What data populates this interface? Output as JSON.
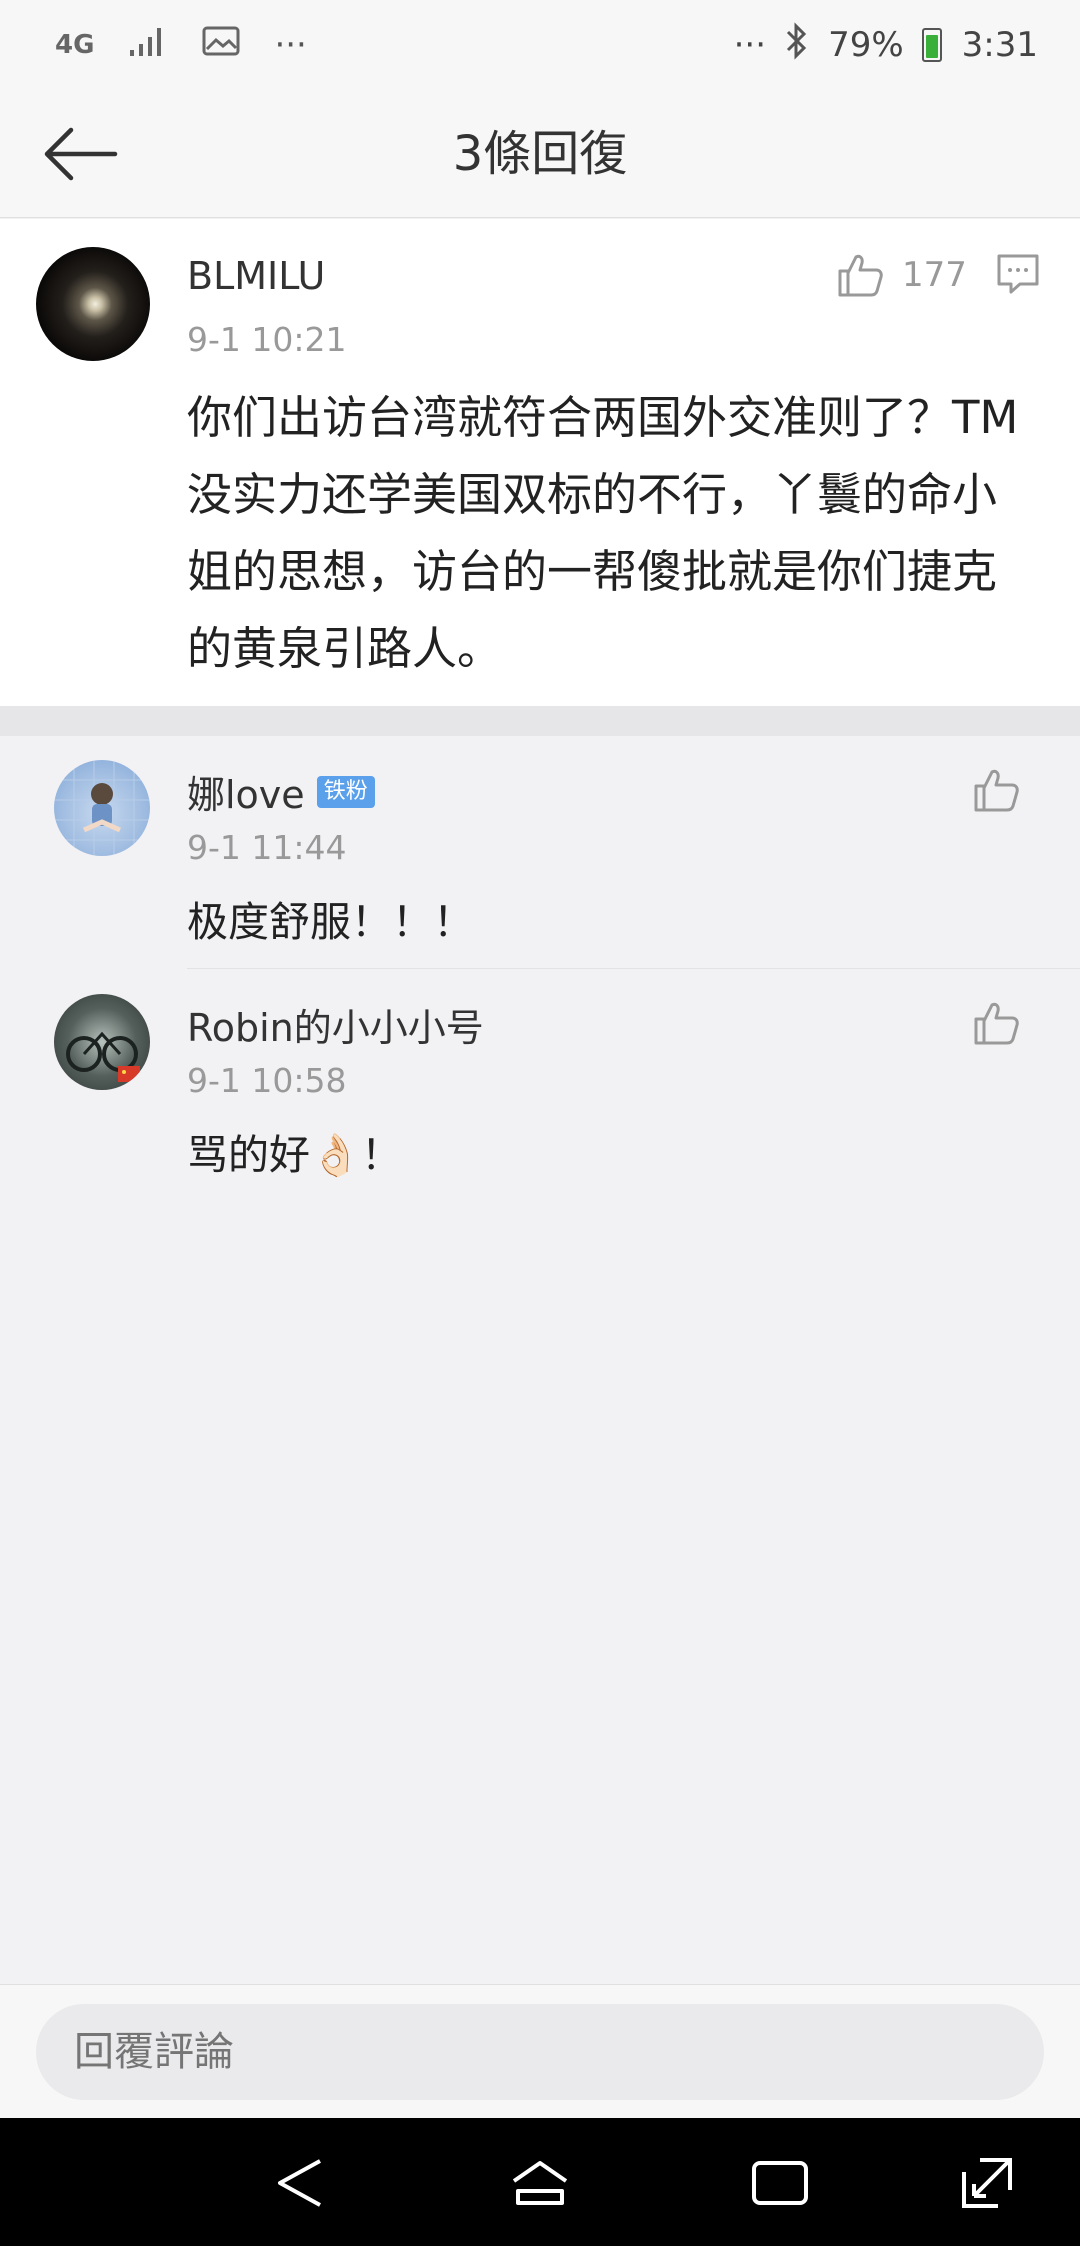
{
  "status_bar": {
    "network": "4G",
    "more_left": "···",
    "more_right": "···",
    "battery": "79%",
    "time": "3:31"
  },
  "header": {
    "title": "3條回復"
  },
  "main_comment": {
    "user": "BLMILU",
    "time": "9-1 10:21",
    "likes": "177",
    "text": "你们出访台湾就符合两国外交准则了？TM没实力还学美国双标的不行，丫鬟的命小姐的思想，访台的一帮傻批就是你们捷克的黄泉引路人。"
  },
  "replies": [
    {
      "user": "娜love",
      "badge": "铁粉",
      "time": "9-1 11:44",
      "text": "极度舒服！！！"
    },
    {
      "user": "Robin的小小小号",
      "time": "9-1 10:58",
      "text": "骂的好👌🏻！"
    }
  ],
  "reply_bar": {
    "placeholder": "回覆評論"
  }
}
